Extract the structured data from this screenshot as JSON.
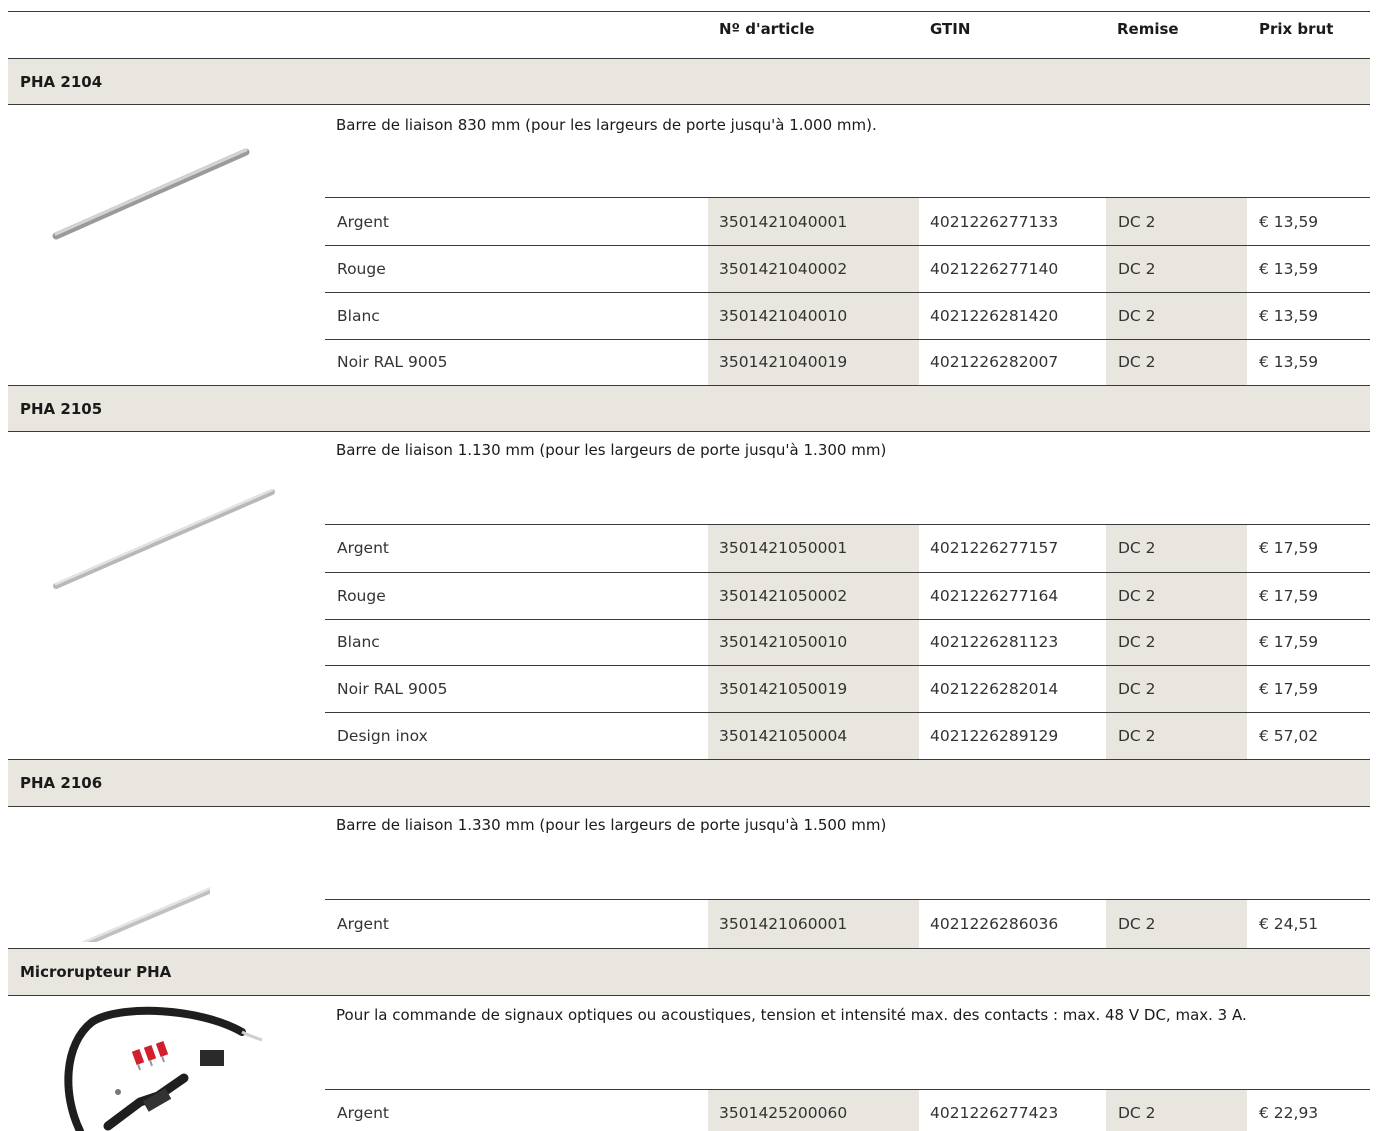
{
  "columns": {
    "article": "Nº d'article",
    "gtin": "GTIN",
    "discount": "Remise",
    "price": "Prix brut"
  },
  "products": [
    {
      "name": "PHA 2104",
      "image_icon": "connecting-bar-icon",
      "description": "Barre de liaison 830 mm (pour les largeurs de porte jusqu'à 1.000 mm).",
      "rows": [
        {
          "variant": "Argent",
          "article": "3501421040001",
          "gtin": "4021226277133",
          "discount": "DC 2",
          "price": "€ 13,59"
        },
        {
          "variant": "Rouge",
          "article": "3501421040002",
          "gtin": "4021226277140",
          "discount": "DC 2",
          "price": "€ 13,59"
        },
        {
          "variant": "Blanc",
          "article": "3501421040010",
          "gtin": "4021226281420",
          "discount": "DC 2",
          "price": "€ 13,59"
        },
        {
          "variant": "Noir RAL 9005",
          "article": "3501421040019",
          "gtin": "4021226282007",
          "discount": "DC 2",
          "price": "€ 13,59"
        }
      ]
    },
    {
      "name": "PHA 2105",
      "image_icon": "connecting-bar-icon",
      "description": "Barre de liaison 1.130 mm (pour les largeurs de porte jusqu'à 1.300 mm)",
      "rows": [
        {
          "variant": "Argent",
          "article": "3501421050001",
          "gtin": "4021226277157",
          "discount": "DC 2",
          "price": "€ 17,59"
        },
        {
          "variant": "Rouge",
          "article": "3501421050002",
          "gtin": "4021226277164",
          "discount": "DC 2",
          "price": "€ 17,59"
        },
        {
          "variant": "Blanc",
          "article": "3501421050010",
          "gtin": "4021226281123",
          "discount": "DC 2",
          "price": "€ 17,59"
        },
        {
          "variant": "Noir RAL 9005",
          "article": "3501421050019",
          "gtin": "4021226282014",
          "discount": "DC 2",
          "price": "€ 17,59"
        },
        {
          "variant": "Design inox",
          "article": "3501421050004",
          "gtin": "4021226289129",
          "discount": "DC 2",
          "price": "€ 57,02"
        }
      ]
    },
    {
      "name": "PHA 2106",
      "image_icon": "connecting-bar-icon",
      "description": "Barre de liaison 1.330 mm (pour les largeurs de porte jusqu'à 1.500 mm)",
      "rows": [
        {
          "variant": "Argent",
          "article": "3501421060001",
          "gtin": "4021226286036",
          "discount": "DC 2",
          "price": "€ 24,51"
        }
      ]
    },
    {
      "name": "Microrupteur PHA",
      "image_icon": "microswitch-cable-icon",
      "description": "Pour la commande de signaux optiques ou acoustiques, tension et intensité max. des contacts : max. 48 V DC, max. 3 A.",
      "rows": [
        {
          "variant": "Argent",
          "article": "3501425200060",
          "gtin": "4021226277423",
          "discount": "DC 2",
          "price": "€ 22,93"
        }
      ]
    }
  ]
}
